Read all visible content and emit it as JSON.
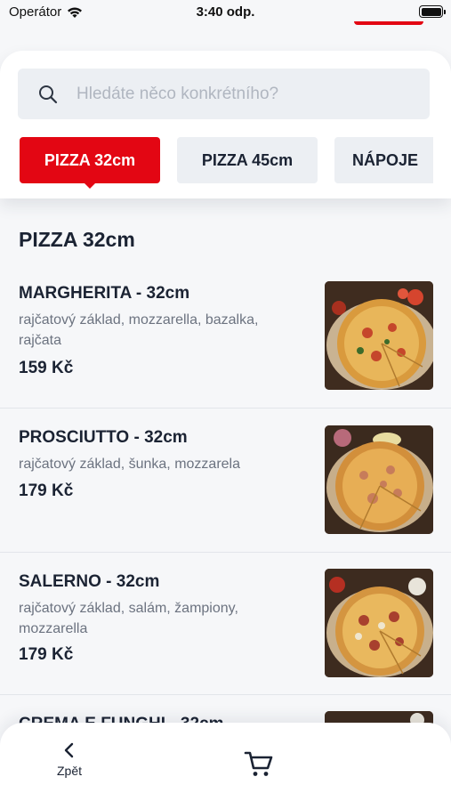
{
  "status_bar": {
    "carrier": "Operátor",
    "time": "3:40 odp."
  },
  "search": {
    "placeholder": "Hledáte něco konkrétního?",
    "value": ""
  },
  "tabs": [
    {
      "label": "PIZZA 32cm",
      "active": true
    },
    {
      "label": "PIZZA 45cm",
      "active": false
    },
    {
      "label": "NÁPOJE",
      "active": false
    }
  ],
  "section": {
    "title": "PIZZA 32cm"
  },
  "items": [
    {
      "name": "MARGHERITA - 32cm",
      "description": "rajčatový základ, mozzarella, bazalka, rajčata",
      "price": "159 Kč"
    },
    {
      "name": "PROSCIUTTO - 32cm",
      "description": "rajčatový základ, šunka, mozzarela",
      "price": "179 Kč"
    },
    {
      "name": "SALERNO - 32cm",
      "description": "rajčatový základ, salám, žampiony, mozzarella",
      "price": "179 Kč"
    },
    {
      "name": "CREMA E FUNGHI - 32cm",
      "description": "",
      "price": ""
    }
  ],
  "bottom_nav": {
    "back_label": "Zpět",
    "back_icon": "chevron-left-icon",
    "cart_icon": "cart-icon"
  },
  "colors": {
    "accent": "#e30613",
    "text": "#1b2333",
    "muted": "#6c7380",
    "chip": "#eceff3"
  }
}
